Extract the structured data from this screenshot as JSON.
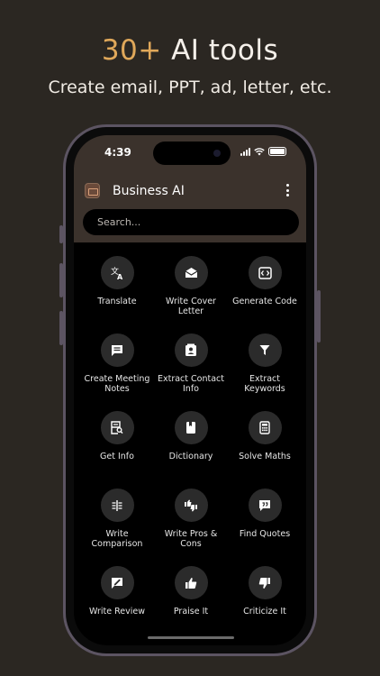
{
  "promo": {
    "accent": "30+",
    "title_rest": " AI tools",
    "subtitle": "Create email, PPT, ad, letter, etc."
  },
  "status": {
    "time": "4:39"
  },
  "app": {
    "title": "Business AI",
    "search_placeholder": "Search..."
  },
  "tools": [
    {
      "label": "Translate",
      "icon": "translate-icon"
    },
    {
      "label": "Write Cover Letter",
      "icon": "envelope-icon"
    },
    {
      "label": "Generate Code",
      "icon": "code-icon"
    },
    {
      "label": "Create Meeting Notes",
      "icon": "notes-icon"
    },
    {
      "label": "Extract Contact Info",
      "icon": "contact-card-icon"
    },
    {
      "label": "Extract Keywords",
      "icon": "filter-icon"
    },
    {
      "label": "Get Info",
      "icon": "document-search-icon"
    },
    {
      "label": "Dictionary",
      "icon": "book-icon"
    },
    {
      "label": "Solve Maths",
      "icon": "calculator-icon"
    },
    {
      "label": "Write Comparison",
      "icon": "compare-icon"
    },
    {
      "label": "Write Pros & Cons",
      "icon": "thumbs-up-down-icon"
    },
    {
      "label": "Find Quotes",
      "icon": "quote-icon"
    },
    {
      "label": "Write Review",
      "icon": "review-icon"
    },
    {
      "label": "Praise It",
      "icon": "thumbs-up-icon"
    },
    {
      "label": "Criticize It",
      "icon": "thumbs-down-icon"
    }
  ],
  "colors": {
    "accent": "#e0a85a",
    "background": "#2b2722",
    "app_bar": "#3b322c",
    "tile": "#2b2b2b"
  }
}
